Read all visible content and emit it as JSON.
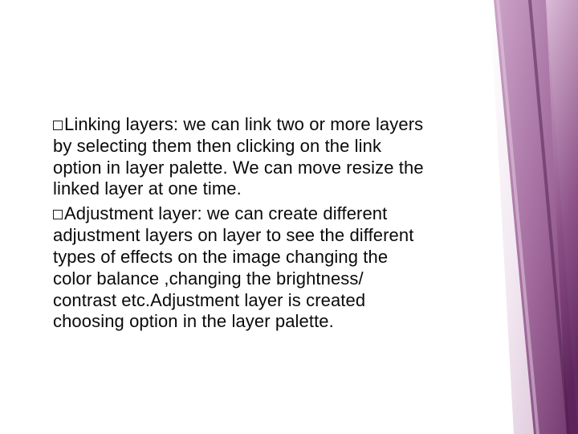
{
  "slide": {
    "bullets": [
      {
        "lead": "Linking",
        "rest": " layers: we can link two or more layers by selecting them then clicking on the link option in layer palette. We can move resize the linked layer at one time."
      },
      {
        "lead": "Adjustment",
        "rest": " layer: we can create different adjustment layers on layer to see the different types of effects on the image changing the color balance ,changing the brightness/ contrast etc.Adjustment layer is created choosing option in the layer palette."
      }
    ]
  },
  "decor": {
    "gradient_stops": [
      "#7a3b76",
      "#8a4d87",
      "#c79bc3",
      "#9e6c9a",
      "#6d2a6a"
    ]
  }
}
